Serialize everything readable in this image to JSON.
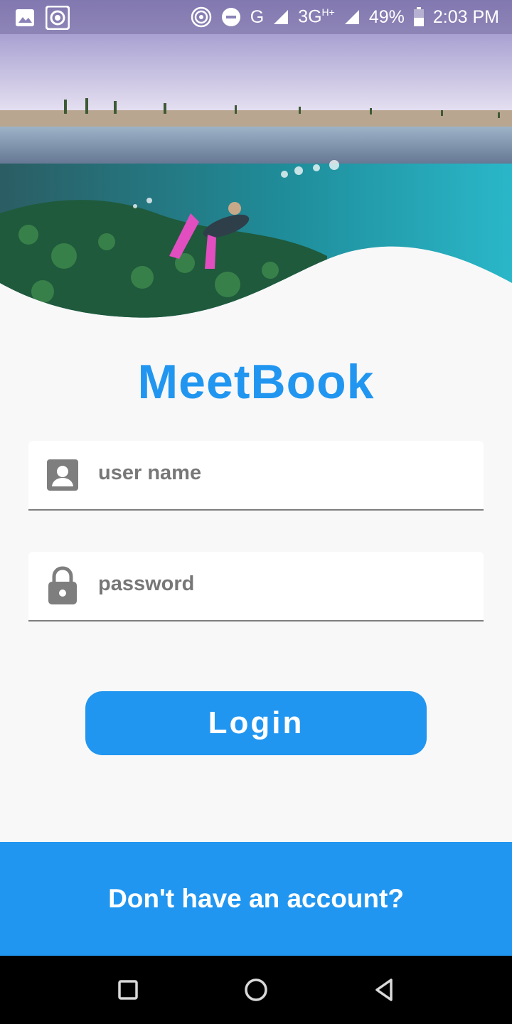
{
  "status_bar": {
    "icons_left": [
      "gallery-icon",
      "record-icon"
    ],
    "icons_right": [
      "hotspot-icon",
      "dnd-icon"
    ],
    "network_g": "G",
    "network_3g": "3G",
    "network_3g_sup": "H+",
    "battery": "49%",
    "time": "2:03 PM"
  },
  "app": {
    "title": "MeetBook"
  },
  "form": {
    "username_placeholder": "user name",
    "username_value": "",
    "password_placeholder": "password",
    "password_value": "",
    "login_label": "Login"
  },
  "footer": {
    "signup_text": "Don't have an account?"
  },
  "colors": {
    "accent": "#2196f0",
    "background": "#f8f8f9",
    "icon_gray": "#7e7e7e"
  }
}
